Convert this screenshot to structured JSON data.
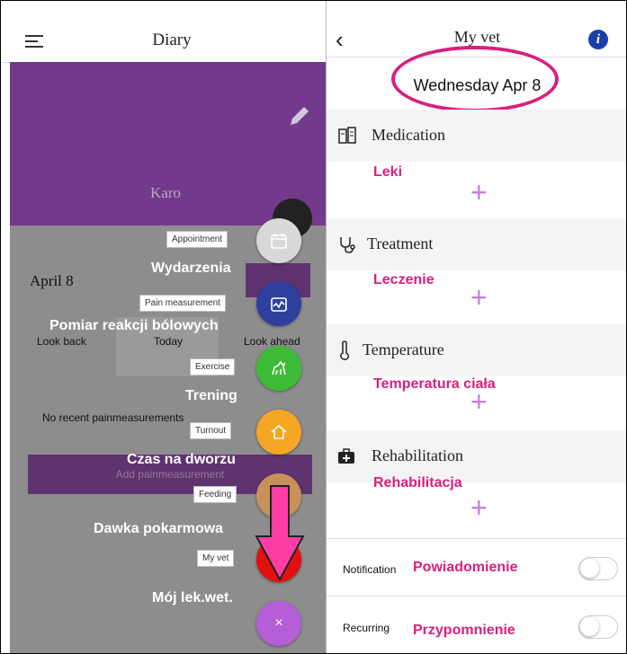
{
  "left": {
    "title": "Diary",
    "profile_name": "Karo",
    "date": "April 8",
    "tabs": [
      "Look back",
      "Today",
      "Look ahead"
    ],
    "no_recent": "No recent painmeasurements",
    "add_button": "Add painmeasurement",
    "fab_items": [
      {
        "label": "Appointment",
        "caption": "Wydarzenia",
        "color": "#d8d8d8",
        "icon": "calendar-icon"
      },
      {
        "label": "Pain measurement",
        "caption": "Pomiar reakcji bólowych",
        "color": "#2e3f9e",
        "icon": "chart-icon"
      },
      {
        "label": "Exercise",
        "caption": "Trening",
        "color": "#3dbb37",
        "icon": "horse-icon"
      },
      {
        "label": "Turnout",
        "caption": "Czas na dworzu",
        "color": "#f5a623",
        "icon": "house-icon"
      },
      {
        "label": "Feeding",
        "caption": "Dawka pokarmowa",
        "color": "#c8915a",
        "icon": "feed-icon"
      },
      {
        "label": "My vet",
        "caption": "Mój lek.wet.",
        "color": "#e0110f",
        "icon": "stethoscope-icon"
      }
    ],
    "close_fab": "×",
    "close_fab_color": "#b65ed8"
  },
  "right": {
    "title": "My vet",
    "date": "Wednesday Apr 8",
    "sections": [
      {
        "title": "Medication",
        "annotation": "Leki",
        "icon": "pill-icon"
      },
      {
        "title": "Treatment",
        "annotation": "Leczenie",
        "icon": "stethoscope-icon"
      },
      {
        "title": "Temperature",
        "annotation": "Temperatura ciała",
        "icon": "thermometer-icon"
      },
      {
        "title": "Rehabilitation",
        "annotation": "Rehabilitacja",
        "icon": "first-aid-icon"
      }
    ],
    "rows": [
      {
        "label": "Notification",
        "annotation": "Powiadomienie",
        "on": false
      },
      {
        "label": "Recurring",
        "annotation": "Przypomnienie",
        "on": false
      }
    ],
    "plus": "+"
  },
  "colors": {
    "accent_pink": "#d81f7e",
    "purple": "#73398a",
    "plus_violet": "#c77de0"
  }
}
